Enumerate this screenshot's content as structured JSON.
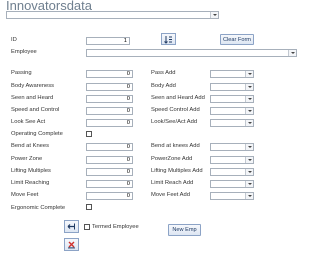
{
  "header": {
    "title": "Innovatorsdata",
    "record_select_value": ""
  },
  "fields": {
    "id_label": "ID",
    "id_value": "1",
    "employee_label": "Employee",
    "employee_value": ""
  },
  "toolbar": {
    "sort_icon": "sort-ascending-icon",
    "clear_form_label": "Clear Form"
  },
  "left_metrics": [
    {
      "label": "Passing",
      "value": "0"
    },
    {
      "label": "Body Awareness",
      "value": "0"
    },
    {
      "label": "Seen and Heard",
      "value": "0"
    },
    {
      "label": "Speed and Control",
      "value": "0"
    },
    {
      "label": "Look See Act",
      "value": "0"
    }
  ],
  "operating_complete_label": "Operating Complete",
  "right_adds": [
    {
      "label": "Pass Add",
      "value": ""
    },
    {
      "label": "Body Add",
      "value": ""
    },
    {
      "label": "Seen and Heard Add",
      "value": ""
    },
    {
      "label": "Speed Control Add",
      "value": ""
    },
    {
      "label": "Look/See/Act Add",
      "value": ""
    }
  ],
  "left_metrics_2": [
    {
      "label": "Bend at Knees",
      "value": "0"
    },
    {
      "label": "Power Zone",
      "value": "0"
    },
    {
      "label": "Lifting Multiples",
      "value": "0"
    },
    {
      "label": "Limit Reaching",
      "value": "0"
    },
    {
      "label": "Move Feet",
      "value": "0"
    }
  ],
  "ergonomic_complete_label": "Ergonomic Complete",
  "right_adds_2": [
    {
      "label": "Bend at knees Add",
      "value": ""
    },
    {
      "label": "PowerZone Add",
      "value": ""
    },
    {
      "label": "Lifting Multiples Add",
      "value": ""
    },
    {
      "label": "Limit Reach Add",
      "value": ""
    },
    {
      "label": "Move Feet Add",
      "value": ""
    }
  ],
  "footer": {
    "termed_label": "Termed Employee",
    "new_emp_label": "New Emp",
    "save_icon": "save-record-icon",
    "delete_icon": "delete-record-icon"
  },
  "colors": {
    "title": "#6f7f8f",
    "button_border": "#8ca3c6",
    "delete_red": "#d0312d"
  }
}
